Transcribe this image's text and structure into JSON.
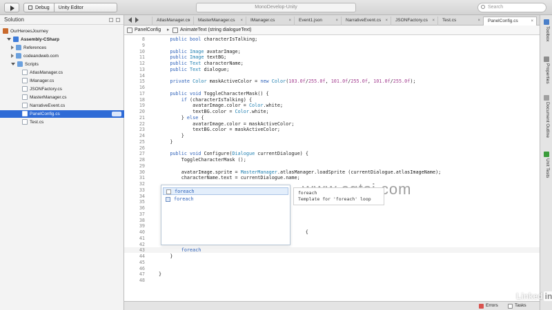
{
  "toolbar": {
    "config": "Debug",
    "target": "Unity Editor",
    "window_title": "MonoDevelop-Unity",
    "search_placeholder": "Search"
  },
  "sidebar": {
    "title": "Solution",
    "items": [
      {
        "label": "OurHeroesJourney",
        "kind": "solution"
      },
      {
        "label": "Assembly-CSharp",
        "kind": "project"
      },
      {
        "label": "References",
        "kind": "folder"
      },
      {
        "label": "codeandweb.com",
        "kind": "folder"
      },
      {
        "label": "Scripts",
        "kind": "folder"
      },
      {
        "label": "AtlasManager.cs",
        "kind": "file"
      },
      {
        "label": "IManager.cs",
        "kind": "file"
      },
      {
        "label": "JSONFactory.cs",
        "kind": "file"
      },
      {
        "label": "MasterManager.cs",
        "kind": "file"
      },
      {
        "label": "NarrativeEvent.cs",
        "kind": "file"
      },
      {
        "label": "PanelConfig.cs",
        "kind": "file",
        "selected": true
      },
      {
        "label": "Test.cs",
        "kind": "file"
      }
    ]
  },
  "tabs": [
    {
      "label": "AtlasManager.cs"
    },
    {
      "label": "MasterManager.cs"
    },
    {
      "label": "IManager.cs"
    },
    {
      "label": "Event1.json"
    },
    {
      "label": "NarrativeEvent.cs"
    },
    {
      "label": "JSONFactory.cs"
    },
    {
      "label": "Test.cs"
    },
    {
      "label": "PanelConfig.cs",
      "active": true
    }
  ],
  "pathbar": {
    "class_name": "PanelConfig",
    "method_name": "AnimateText (string dialogueText)"
  },
  "code_lines": [
    {
      "n": "8",
      "t": "    public bool characterIsTalking;"
    },
    {
      "n": "9",
      "t": ""
    },
    {
      "n": "10",
      "t": "    public Image avatarImage;"
    },
    {
      "n": "11",
      "t": "    public Image textBG;"
    },
    {
      "n": "12",
      "t": "    public Text characterName;"
    },
    {
      "n": "13",
      "t": "    public Text dialogue;"
    },
    {
      "n": "14",
      "t": ""
    },
    {
      "n": "15",
      "t": "    private Color maskActiveColor = new Color(103.0f/255.0f, 101.0f/255.0f, 101.0f/255.0f);"
    },
    {
      "n": "16",
      "t": ""
    },
    {
      "n": "17",
      "t": "    public void ToggleCharacterMask() {"
    },
    {
      "n": "18",
      "t": "        if (characterIsTalking) {"
    },
    {
      "n": "19",
      "t": "            avatarImage.color = Color.white;"
    },
    {
      "n": "20",
      "t": "            textBG.color = Color.white;"
    },
    {
      "n": "21",
      "t": "        } else {"
    },
    {
      "n": "22",
      "t": "            avatarImage.color = maskActiveColor;"
    },
    {
      "n": "23",
      "t": "            textBG.color = maskActiveColor;"
    },
    {
      "n": "24",
      "t": "        }"
    },
    {
      "n": "25",
      "t": "    }"
    },
    {
      "n": "26",
      "t": ""
    },
    {
      "n": "27",
      "t": "    public void Configure(Dialogue currentDialogue) {"
    },
    {
      "n": "28",
      "t": "        ToggleCharacterMask ();"
    },
    {
      "n": "29",
      "t": ""
    },
    {
      "n": "30",
      "t": "        avatarImage.sprite = MasterManager.atlasManager.loadSprite (currentDialogue.atlasImageName);"
    },
    {
      "n": "31",
      "t": "        characterName.text = currentDialogue.name;"
    },
    {
      "n": "32",
      "t": ""
    },
    {
      "n": "33",
      "t": ""
    },
    {
      "n": "34",
      "t": ""
    },
    {
      "n": "35",
      "t": ""
    },
    {
      "n": "36",
      "t": ""
    },
    {
      "n": "37",
      "t": ""
    },
    {
      "n": "38",
      "t": "    }"
    },
    {
      "n": "39",
      "t": ""
    },
    {
      "n": "40",
      "t": "    }                                               {"
    },
    {
      "n": "41",
      "t": ""
    },
    {
      "n": "42",
      "t": ""
    },
    {
      "n": "43",
      "t": "        foreach"
    },
    {
      "n": "44",
      "t": "    }"
    },
    {
      "n": "45",
      "t": ""
    },
    {
      "n": "46",
      "t": ""
    },
    {
      "n": "47",
      "t": "}"
    },
    {
      "n": "48",
      "t": ""
    }
  ],
  "completion": {
    "items": [
      "foreach",
      "foreach"
    ],
    "tooltip_title": "foreach",
    "tooltip_desc": "Template for 'foreach' loop"
  },
  "right_panels": [
    "Toolbox",
    "Properties",
    "Document Outline",
    "Unit Tests"
  ],
  "status": {
    "errors": "Errors",
    "tasks": "Tasks"
  },
  "watermark": "www.cgtsj.com",
  "brand": {
    "linked": "Linked",
    "in": "in"
  },
  "colors": {
    "selection": "#2f6bd6",
    "keyword": "#2b5fb8"
  }
}
